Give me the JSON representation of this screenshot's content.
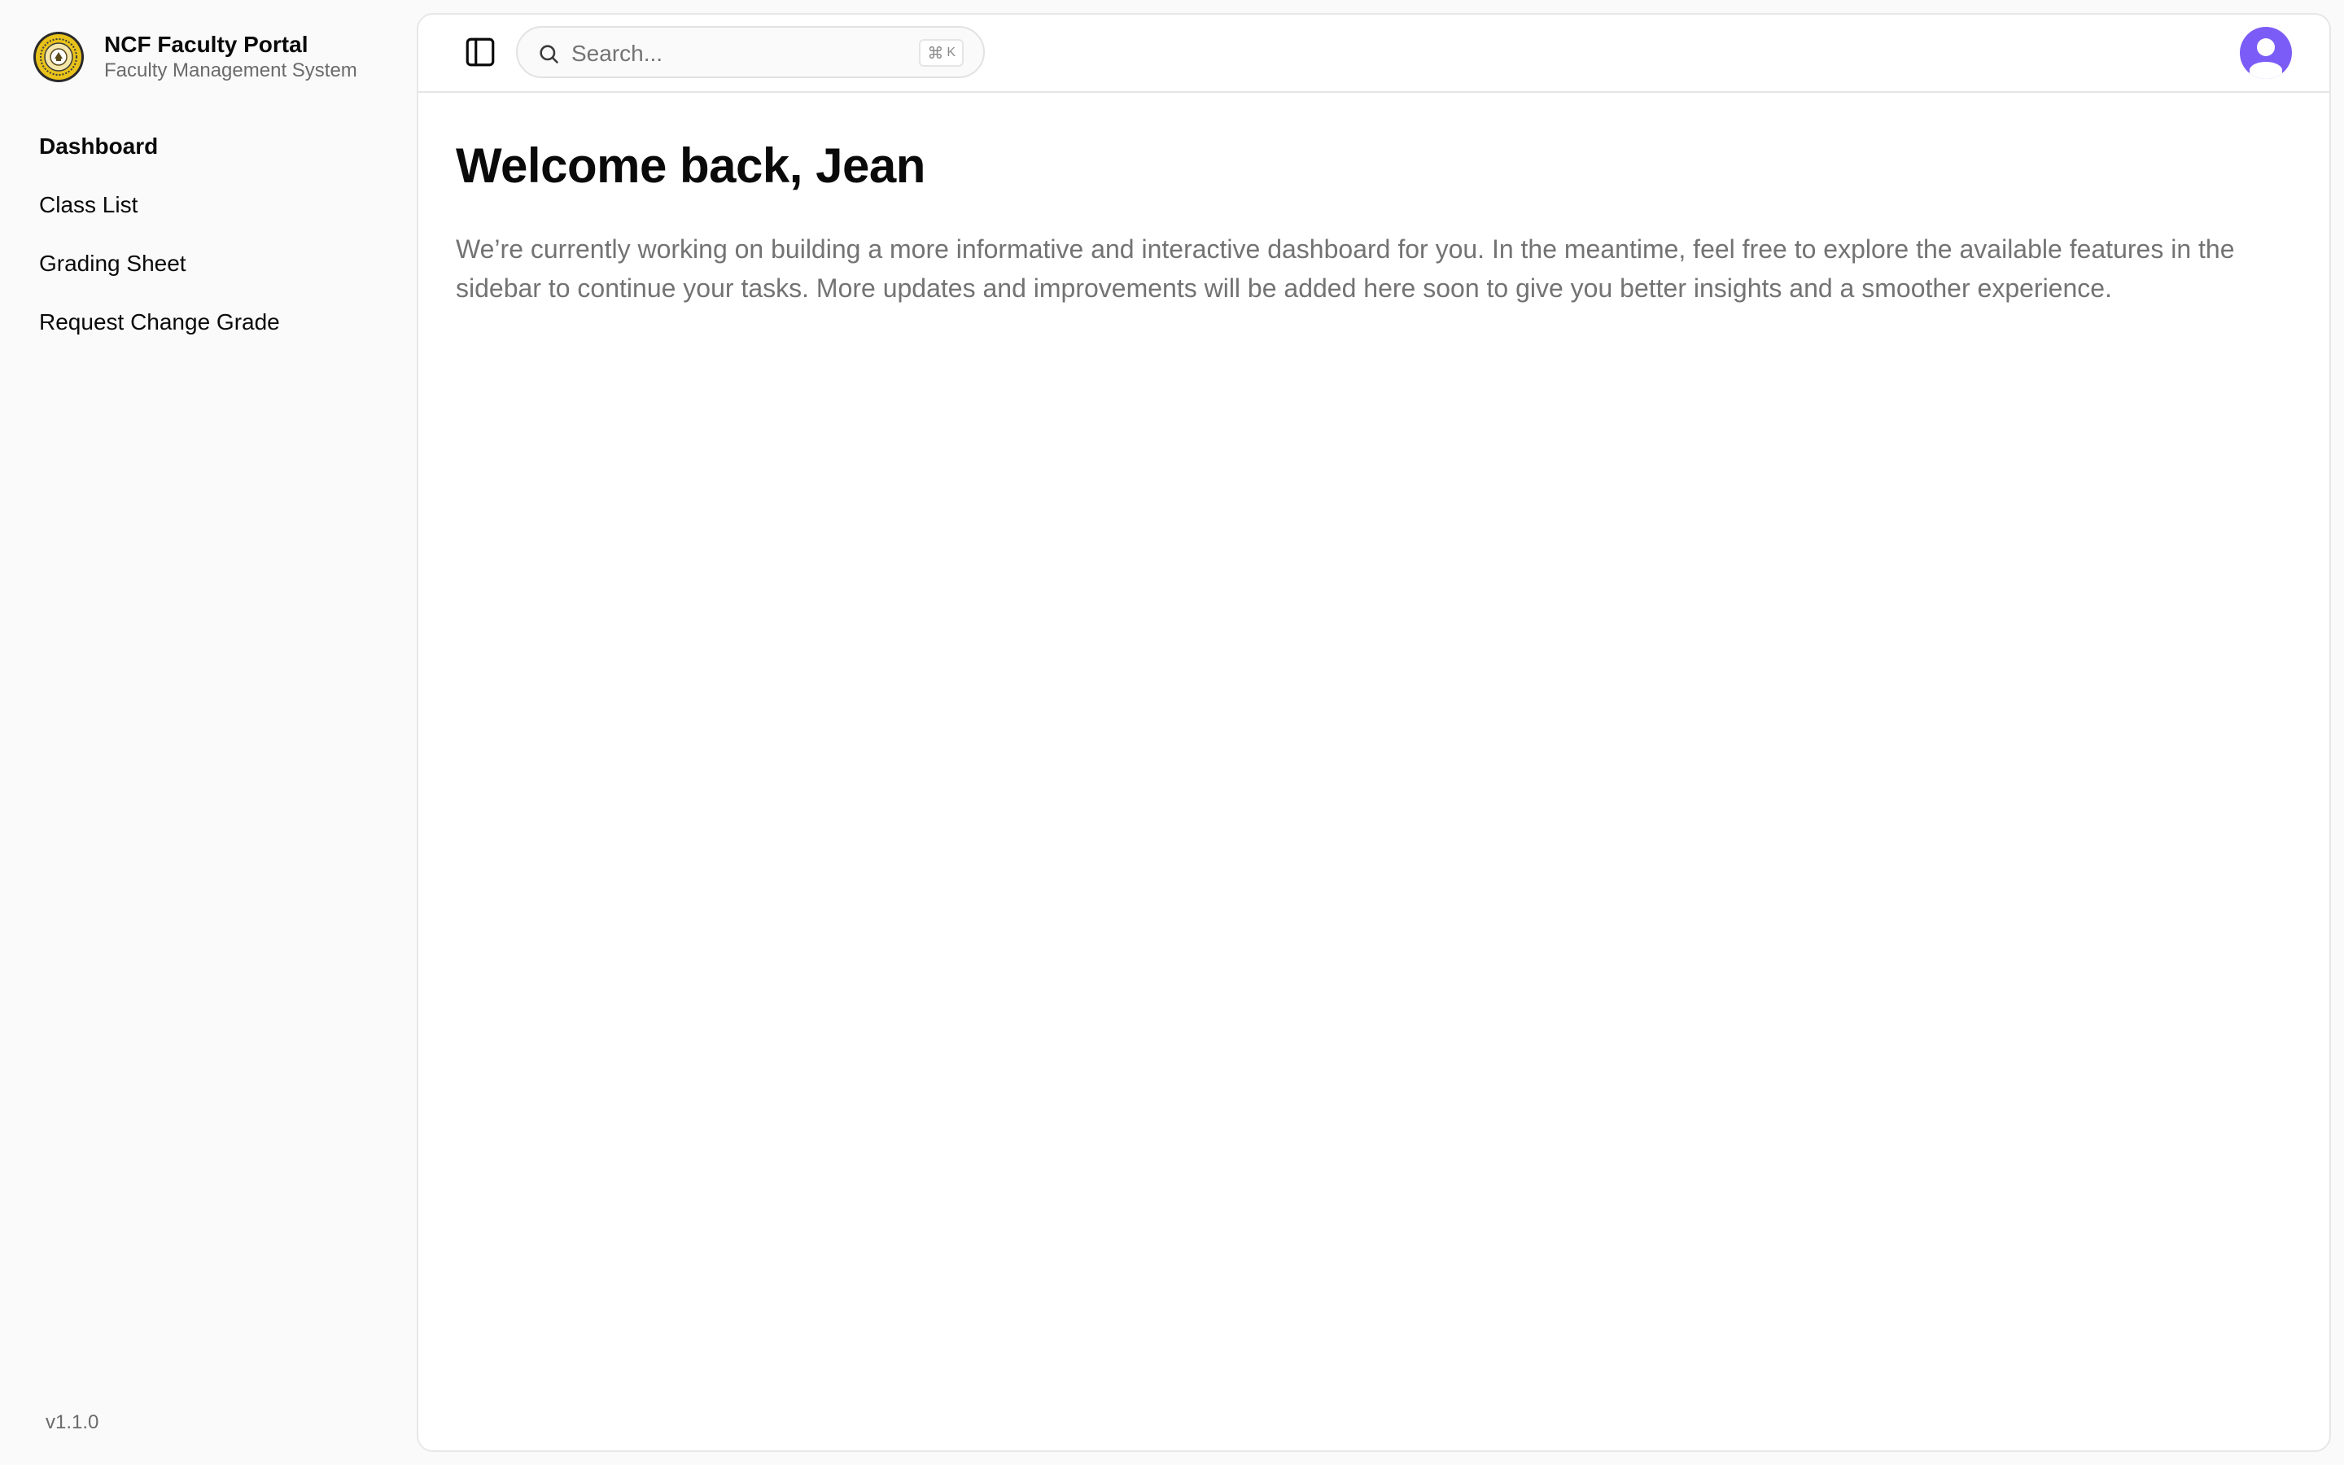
{
  "app": {
    "title": "NCF Faculty Portal",
    "subtitle": "Faculty Management System",
    "version": "v1.1.0"
  },
  "sidebar": {
    "items": [
      {
        "label": "Dashboard",
        "active": true
      },
      {
        "label": "Class List",
        "active": false
      },
      {
        "label": "Grading Sheet",
        "active": false
      },
      {
        "label": "Request Change Grade",
        "active": false
      }
    ]
  },
  "topbar": {
    "toggle_icon": "sidebar-toggle-icon",
    "search": {
      "placeholder": "Search...",
      "value": "",
      "shortcut_symbol": "⌘",
      "shortcut_key": "K"
    },
    "avatar_icon": "user-icon",
    "avatar_color": "#7c5cf6"
  },
  "main": {
    "title": "Welcome back, Jean",
    "description": "We’re currently working on building a more informative and interactive dashboard for you. In the meantime, feel free to explore the available features in the sidebar to continue your tasks. More updates and improvements will be added here soon to give you better insights and a smoother experience."
  },
  "colors": {
    "sidebar_bg": "#fafafa",
    "main_bg": "#ffffff",
    "text_primary": "#0a0a0a",
    "text_muted": "#737373",
    "logo_gold": "#e8c21a",
    "accent": "#7c5cf6"
  }
}
